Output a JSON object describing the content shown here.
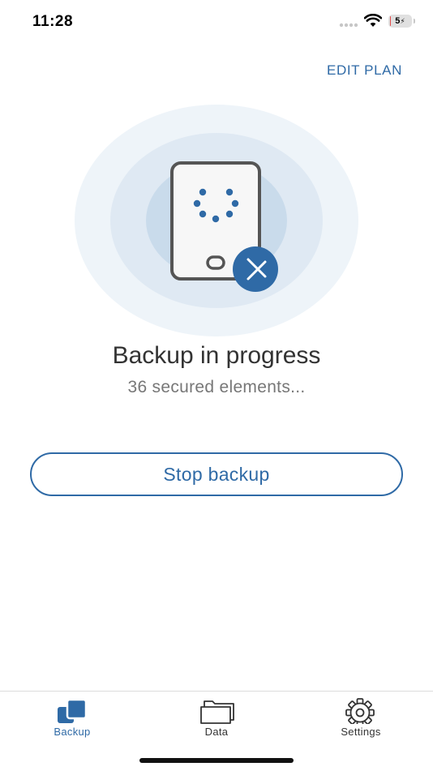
{
  "status_bar": {
    "time": "11:28",
    "battery_label": "5",
    "battery_level_percent": 5,
    "battery_color": "#e24b4b"
  },
  "header": {
    "edit_plan_label": "EDIT PLAN"
  },
  "illustration": {
    "icons": [
      "phone-icon",
      "spinner-dots-icon",
      "brand-badge-icon"
    ]
  },
  "status": {
    "title": "Backup in progress",
    "subtitle": "36 secured elements..."
  },
  "actions": {
    "stop_label": "Stop backup"
  },
  "tabs": [
    {
      "label": "Backup",
      "icon": "backup-icon",
      "active": true
    },
    {
      "label": "Data",
      "icon": "folder-icon",
      "active": false
    },
    {
      "label": "Settings",
      "icon": "gear-icon",
      "active": false
    }
  ],
  "colors": {
    "accent": "#2f6aa6",
    "active_tab": "#2f6aa6",
    "inactive_tab": "#333333"
  }
}
